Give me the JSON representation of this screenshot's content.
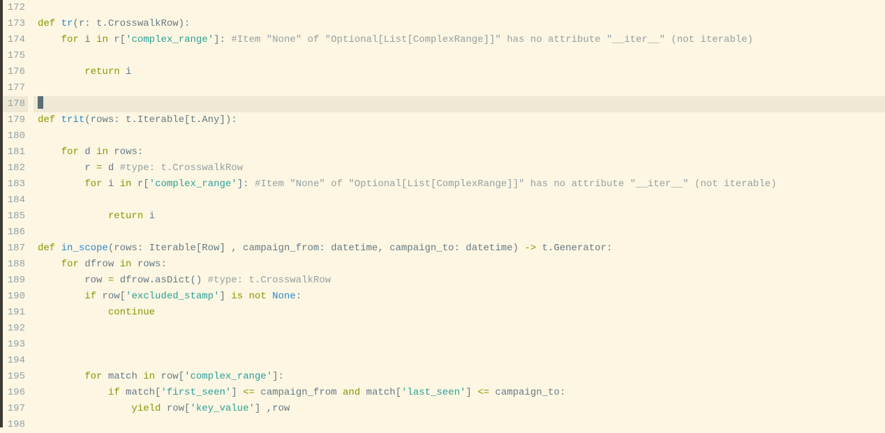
{
  "editor": {
    "first_line_number": 172,
    "current_line_index": 6,
    "lines": [
      {
        "tokens": []
      },
      {
        "tokens": [
          {
            "t": "kw",
            "v": "def "
          },
          {
            "t": "fn",
            "v": "tr"
          },
          {
            "t": "punc",
            "v": "(r: t.CrosswalkRow):"
          }
        ]
      },
      {
        "tokens": [
          {
            "t": "punc",
            "v": "    "
          },
          {
            "t": "kw",
            "v": "for"
          },
          {
            "t": "punc",
            "v": " i "
          },
          {
            "t": "kw",
            "v": "in"
          },
          {
            "t": "punc",
            "v": " r["
          },
          {
            "t": "str",
            "v": "'complex_range'"
          },
          {
            "t": "punc",
            "v": "]: "
          },
          {
            "t": "cmt",
            "v": "#Item \"None\" of \"Optional[List[ComplexRange]]\" has no attribute \"__iter__\" (not iterable)"
          }
        ]
      },
      {
        "tokens": []
      },
      {
        "tokens": [
          {
            "t": "punc",
            "v": "        "
          },
          {
            "t": "kw",
            "v": "return"
          },
          {
            "t": "punc",
            "v": " i"
          }
        ]
      },
      {
        "tokens": []
      },
      {
        "tokens": [
          {
            "t": "cursor",
            "v": ""
          }
        ]
      },
      {
        "tokens": [
          {
            "t": "kw",
            "v": "def "
          },
          {
            "t": "fn",
            "v": "trit"
          },
          {
            "t": "punc",
            "v": "(rows: t.Iterable[t.Any]):"
          }
        ]
      },
      {
        "tokens": []
      },
      {
        "tokens": [
          {
            "t": "punc",
            "v": "    "
          },
          {
            "t": "kw",
            "v": "for"
          },
          {
            "t": "punc",
            "v": " d "
          },
          {
            "t": "kw",
            "v": "in"
          },
          {
            "t": "punc",
            "v": " rows:"
          }
        ]
      },
      {
        "tokens": [
          {
            "t": "punc",
            "v": "        r "
          },
          {
            "t": "kw",
            "v": "="
          },
          {
            "t": "punc",
            "v": " d "
          },
          {
            "t": "cmt",
            "v": "#type: t.CrosswalkRow"
          }
        ]
      },
      {
        "tokens": [
          {
            "t": "punc",
            "v": "        "
          },
          {
            "t": "kw",
            "v": "for"
          },
          {
            "t": "punc",
            "v": " i "
          },
          {
            "t": "kw",
            "v": "in"
          },
          {
            "t": "punc",
            "v": " r["
          },
          {
            "t": "str",
            "v": "'complex_range'"
          },
          {
            "t": "punc",
            "v": "]: "
          },
          {
            "t": "cmt",
            "v": "#Item \"None\" of \"Optional[List[ComplexRange]]\" has no attribute \"__iter__\" (not iterable)"
          }
        ]
      },
      {
        "tokens": []
      },
      {
        "tokens": [
          {
            "t": "punc",
            "v": "            "
          },
          {
            "t": "kw",
            "v": "return"
          },
          {
            "t": "punc",
            "v": " i"
          }
        ]
      },
      {
        "tokens": []
      },
      {
        "tokens": [
          {
            "t": "kw",
            "v": "def "
          },
          {
            "t": "fn",
            "v": "in_scope"
          },
          {
            "t": "punc",
            "v": "(rows: Iterable[Row] , campaign_from: datetime, campaign_to: datetime) "
          },
          {
            "t": "kw",
            "v": "->"
          },
          {
            "t": "punc",
            "v": " t.Generator:"
          }
        ]
      },
      {
        "tokens": [
          {
            "t": "punc",
            "v": "    "
          },
          {
            "t": "kw",
            "v": "for"
          },
          {
            "t": "punc",
            "v": " dfrow "
          },
          {
            "t": "kw",
            "v": "in"
          },
          {
            "t": "punc",
            "v": " rows:"
          }
        ]
      },
      {
        "tokens": [
          {
            "t": "punc",
            "v": "        row "
          },
          {
            "t": "kw",
            "v": "="
          },
          {
            "t": "punc",
            "v": " dfrow.asDict() "
          },
          {
            "t": "cmt",
            "v": "#type: t.CrosswalkRow"
          }
        ]
      },
      {
        "tokens": [
          {
            "t": "punc",
            "v": "        "
          },
          {
            "t": "kw",
            "v": "if"
          },
          {
            "t": "punc",
            "v": " row["
          },
          {
            "t": "str",
            "v": "'excluded_stamp'"
          },
          {
            "t": "punc",
            "v": "] "
          },
          {
            "t": "kw",
            "v": "is not "
          },
          {
            "t": "fn",
            "v": "None"
          },
          {
            "t": "punc",
            "v": ":"
          }
        ]
      },
      {
        "tokens": [
          {
            "t": "punc",
            "v": "            "
          },
          {
            "t": "kw",
            "v": "continue"
          }
        ]
      },
      {
        "tokens": []
      },
      {
        "tokens": []
      },
      {
        "tokens": []
      },
      {
        "tokens": [
          {
            "t": "punc",
            "v": "        "
          },
          {
            "t": "kw",
            "v": "for"
          },
          {
            "t": "punc",
            "v": " match "
          },
          {
            "t": "kw",
            "v": "in"
          },
          {
            "t": "punc",
            "v": " row["
          },
          {
            "t": "str",
            "v": "'complex_range'"
          },
          {
            "t": "punc",
            "v": "]:"
          }
        ]
      },
      {
        "tokens": [
          {
            "t": "punc",
            "v": "            "
          },
          {
            "t": "kw",
            "v": "if"
          },
          {
            "t": "punc",
            "v": " match["
          },
          {
            "t": "str",
            "v": "'first_seen'"
          },
          {
            "t": "punc",
            "v": "] "
          },
          {
            "t": "kw",
            "v": "<="
          },
          {
            "t": "punc",
            "v": " campaign_from "
          },
          {
            "t": "kw",
            "v": "and"
          },
          {
            "t": "punc",
            "v": " match["
          },
          {
            "t": "str",
            "v": "'last_seen'"
          },
          {
            "t": "punc",
            "v": "] "
          },
          {
            "t": "kw",
            "v": "<="
          },
          {
            "t": "punc",
            "v": " campaign_to:"
          }
        ]
      },
      {
        "tokens": [
          {
            "t": "punc",
            "v": "                "
          },
          {
            "t": "kw",
            "v": "yield"
          },
          {
            "t": "punc",
            "v": " row["
          },
          {
            "t": "str",
            "v": "'key_value'"
          },
          {
            "t": "punc",
            "v": "] ,row"
          }
        ]
      },
      {
        "tokens": []
      }
    ]
  }
}
